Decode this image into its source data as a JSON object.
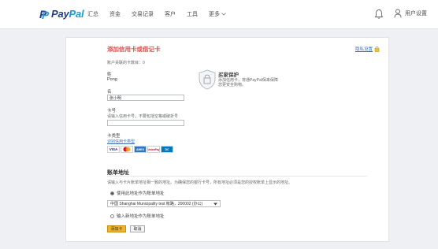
{
  "header": {
    "logo": {
      "pay": "Pay",
      "pal": "Pal"
    },
    "nav": [
      "汇总",
      "资金",
      "交易记录",
      "客户",
      "工具"
    ],
    "more_label": "更多",
    "user_label": "用户设置"
  },
  "form": {
    "title": "添加信用卡或借记卡",
    "ghost_link": "隐私设置",
    "max_cards_note": "账户关联的卡数目：0",
    "surname_label": "姓",
    "surname_value": "Pong",
    "given_name_label": "名",
    "given_name_value": "张小明",
    "card_number_label": "卡号",
    "card_number_hint": "请输入信用卡号，不要包括空格或破折号",
    "card_type_label": "卡类型",
    "card_type_link": "识别信用卡类型",
    "card_brands": [
      "VISA",
      "MC",
      "AMEX",
      "UnionPay",
      "DC"
    ],
    "protection": {
      "title": "买家保护",
      "text": "添加信用卡，将通PayPal保来保障您更安全购物。"
    },
    "billing": {
      "title": "账单地址",
      "hint": "请输入与卡片账单地址相一致的地址。为确保您的银行卡号，所有地址必须是您的授权账单上显示的地址。",
      "option_existing": "使用此地址作为账单地址",
      "address_value": "中国 Shanghai Municipality test 帐路，200002 (办公)",
      "option_new": "输入新地址作为账单地址"
    },
    "add_button": "添加卡",
    "cancel_button": "取消"
  },
  "colors": {
    "brand_dark": "#253b80",
    "brand_light": "#179bd7",
    "accent_button": "#f0b429",
    "title_red": "#d9534f"
  }
}
